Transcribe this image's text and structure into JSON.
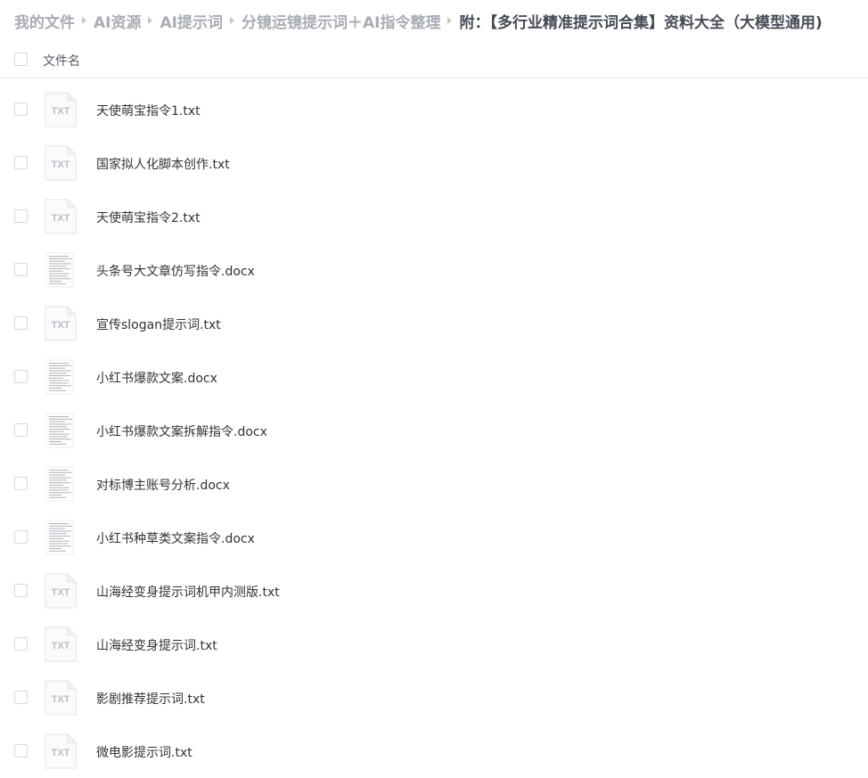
{
  "breadcrumb": {
    "items": [
      {
        "label": "我的文件"
      },
      {
        "label": "AI资源"
      },
      {
        "label": "AI提示词"
      },
      {
        "label": "分镜运镜提示词＋AI指令整理"
      },
      {
        "label": "附：【多行业精准提示词合集】资料大全（大模型通用)"
      }
    ]
  },
  "table": {
    "header": {
      "name_label": "文件名"
    },
    "files": [
      {
        "name": "天使萌宝指令1.txt",
        "icon": "txt-file-icon",
        "icon_text": "TXT"
      },
      {
        "name": "国家拟人化脚本创作.txt",
        "icon": "txt-file-icon",
        "icon_text": "TXT"
      },
      {
        "name": "天使萌宝指令2.txt",
        "icon": "txt-file-icon",
        "icon_text": "TXT"
      },
      {
        "name": "头条号大文章仿写指令.docx",
        "icon": "document-thumbnail-icon"
      },
      {
        "name": "宣传slogan提示词.txt",
        "icon": "txt-file-icon",
        "icon_text": "TXT"
      },
      {
        "name": "小红书爆款文案.docx",
        "icon": "document-thumbnail-icon"
      },
      {
        "name": "小红书爆款文案拆解指令.docx",
        "icon": "document-thumbnail-icon"
      },
      {
        "name": "对标博主账号分析.docx",
        "icon": "document-thumbnail-icon"
      },
      {
        "name": "小红书种草类文案指令.docx",
        "icon": "document-thumbnail-icon"
      },
      {
        "name": "山海经变身提示词机甲内测版.txt",
        "icon": "txt-file-icon",
        "icon_text": "TXT"
      },
      {
        "name": "山海经变身提示词.txt",
        "icon": "txt-file-icon",
        "icon_text": "TXT"
      },
      {
        "name": "影剧推荐提示词.txt",
        "icon": "txt-file-icon",
        "icon_text": "TXT"
      },
      {
        "name": "微电影提示词.txt",
        "icon": "txt-file-icon",
        "icon_text": "TXT"
      }
    ]
  }
}
